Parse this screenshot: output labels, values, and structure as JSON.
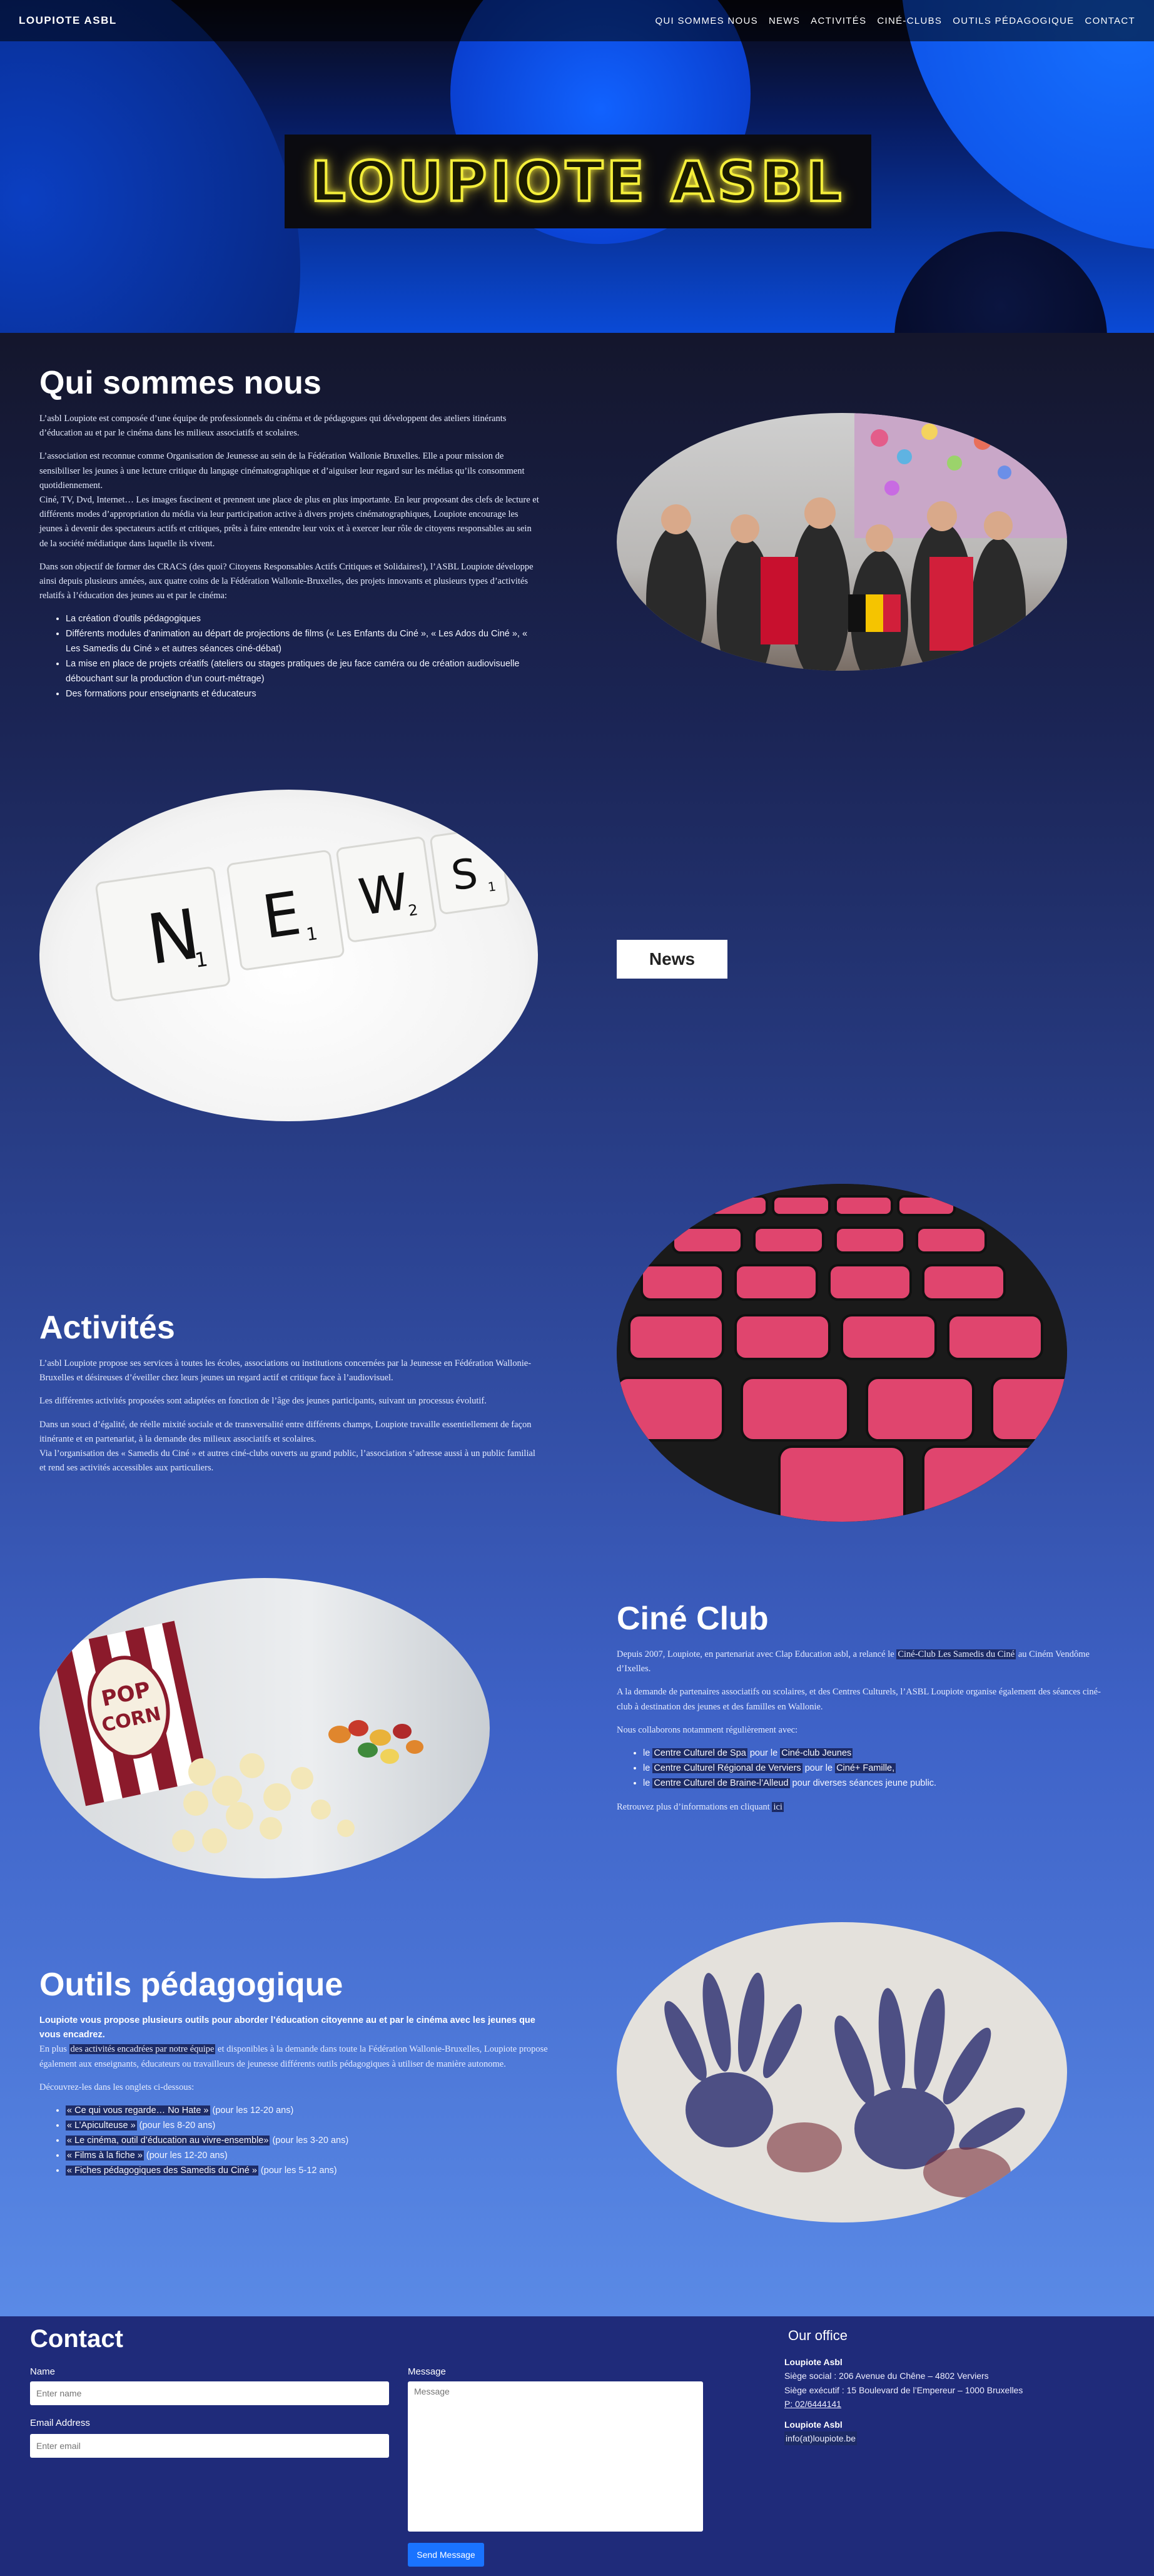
{
  "nav": {
    "brand": "LOUPIOTE ASBL",
    "items": [
      {
        "label": "QUI SOMMES NOUS"
      },
      {
        "label": "NEWS"
      },
      {
        "label": "ACTIVITÉS"
      },
      {
        "label": "CINÉ-CLUBS"
      },
      {
        "label": "OUTILS PÉDAGOGIQUE"
      },
      {
        "label": "CONTACT"
      }
    ]
  },
  "hero": {
    "logo_text": "LOUPIOTE ASBL"
  },
  "about": {
    "title": "Qui sommes nous",
    "p1": "L’asbl Loupiote est composée d’une équipe de professionnels du cinéma et de pédagogues qui développent des ateliers itinérants d’éducation au et par le cinéma dans les milieux associatifs et scolaires.",
    "p2": "L’association est reconnue comme Organisation de Jeunesse au sein de la Fédération Wallonie Bruxelles. Elle a pour mission de sensibiliser les jeunes à une lecture critique du langage cinématographique et d’aiguiser leur regard sur les médias qu’ils consomment quotidiennement.",
    "p3": "Ciné, TV, Dvd, Internet… Les images fascinent et prennent une place de plus en plus importante. En leur proposant des clefs de lecture et différents modes d’appropriation du média via leur participation active à divers projets cinématographiques, Loupiote encourage les jeunes à devenir des spectateurs actifs et critiques, prêts à faire entendre leur voix et à exercer leur rôle de citoyens responsables au sein de la société médiatique dans laquelle ils vivent.",
    "p4": "Dans son objectif de former des CRACS (des quoi? Citoyens Responsables Actifs Critiques et Solidaires!), l’ASBL Loupiote développe ainsi depuis plusieurs années, aux quatre coins de la Fédération Wallonie-Bruxelles, des projets innovants et plusieurs types d’activités relatifs à l’éducation des jeunes au et par le cinéma:",
    "list": [
      "La création d’outils pédagogiques",
      "Différents modules d’animation au départ de projections de films (« Les Enfants du Ciné », « Les Ados du Ciné », « Les Samedis du Ciné » et autres séances ciné-débat)",
      "La mise en place de projets créatifs (ateliers ou stages pratiques de jeu face caméra ou de création audiovisuelle débouchant sur la production d’un court-métrage)",
      "Des formations pour enseignants et éducateurs"
    ]
  },
  "news": {
    "button": "News",
    "tiles": [
      "N",
      "E",
      "W",
      "S"
    ],
    "tile_subs": [
      "1",
      "1",
      "2",
      "1"
    ]
  },
  "activites": {
    "title": "Activités",
    "p1": "L’asbl Loupiote propose ses services à toutes les écoles, associations ou institutions concernées par la Jeunesse en Fédération Wallonie-Bruxelles et désireuses d’éveiller chez leurs jeunes un regard actif et critique face à l’audiovisuel.",
    "p2": "Les différentes activités proposées sont adaptées en fonction de l’âge des jeunes participants, suivant un processus évolutif.",
    "p3": "Dans un souci d’égalité, de réelle mixité sociale et de transversalité entre différents champs, Loupiote travaille essentiellement de façon itinérante et en partenariat, à la demande des milieux associatifs et scolaires.",
    "p4": "Via l’organisation des « Samedis du Ciné » et autres ciné-clubs ouverts au grand public, l’association s’adresse aussi à un public familial et rend ses activités accessibles aux particuliers."
  },
  "cineclub": {
    "title": "Ciné Club",
    "p1a": "Depuis 2007, Loupiote, en partenariat avec Clap Education asbl, a relancé le ",
    "p1link": "Ciné-Club Les Samedis du Ciné",
    "p1b": " au Ciném Vendôme d’Ixelles.",
    "p2": "A la demande de partenaires associatifs ou scolaires, et des Centres Culturels, l’ASBL Loupiote organise également des séances ciné-club à destination des jeunes et des familles en Wallonie.",
    "p3": "Nous collaborons notamment régulièrement avec:",
    "list": [
      {
        "pre": "le ",
        "link": "Centre Culturel de Spa",
        "mid": " pour le ",
        "link2": "Ciné-club Jeunes",
        "post": ""
      },
      {
        "pre": "le ",
        "link": "Centre Culturel Régional de Verviers",
        "mid": " pour le ",
        "link2": "Ciné+ Famille,",
        "post": ""
      },
      {
        "pre": "le ",
        "link": "Centre Culturel de Braine-l’Alleud",
        "mid": " pour diverses séances jeune public.",
        "link2": "",
        "post": ""
      }
    ],
    "p4a": "Retrouvez plus d’informations en cliquant ",
    "p4link": "ici",
    "popcorn_label_1": "POP",
    "popcorn_label_2": "CORN"
  },
  "outils": {
    "title": "Outils pédagogique",
    "intro_bold": "Loupiote vous propose plusieurs outils pour aborder l’éducation citoyenne au et par le cinéma avec les jeunes que vous encadrez.",
    "p1a": "En plus ",
    "p1link": "des activités encadrées par notre équipe",
    "p1b": " et disponibles à la demande dans toute la Fédération Wallonie-Bruxelles, Loupiote propose également aux enseignants, éducateurs ou travailleurs de jeunesse différents outils pédagogiques à utiliser de manière autonome.",
    "p2": "Découvrez-les dans les onglets ci-dessous:",
    "list": [
      {
        "link": "« Ce qui vous regarde… No Hate »",
        "post": " (pour les 12-20 ans)"
      },
      {
        "link": "« L’Apiculteuse »",
        "post": " (pour les 8-20 ans)"
      },
      {
        "link": "« Le cinéma, outil d’éducation au vivre-ensemble»",
        "post": " (pour les 3-20 ans)"
      },
      {
        "link": "« Films à la fiche »",
        "post": " (pour les 12-20 ans)"
      },
      {
        "link": "« Fiches pédagogiques des Samedis du Ciné »",
        "post": " (pour les 5-12 ans)"
      }
    ]
  },
  "contact": {
    "title": "Contact",
    "name_label": "Name",
    "name_placeholder": "Enter name",
    "email_label": "Email Address",
    "email_placeholder": "Enter email",
    "message_label": "Message",
    "message_placeholder": "Message",
    "send": "Send Message",
    "office_title": "Our office",
    "org": "Loupiote Asbl",
    "siege_social": "Siège social : 206 Avenue du Chêne – 4802 Verviers",
    "siege_exec": "Siège exécutif : 15 Boulevard de l’Empereur – 1000 Bruxelles",
    "phone": "P: 02/6444141",
    "org2": "Loupiote Asbl",
    "email": "info(at)loupiote.be"
  }
}
